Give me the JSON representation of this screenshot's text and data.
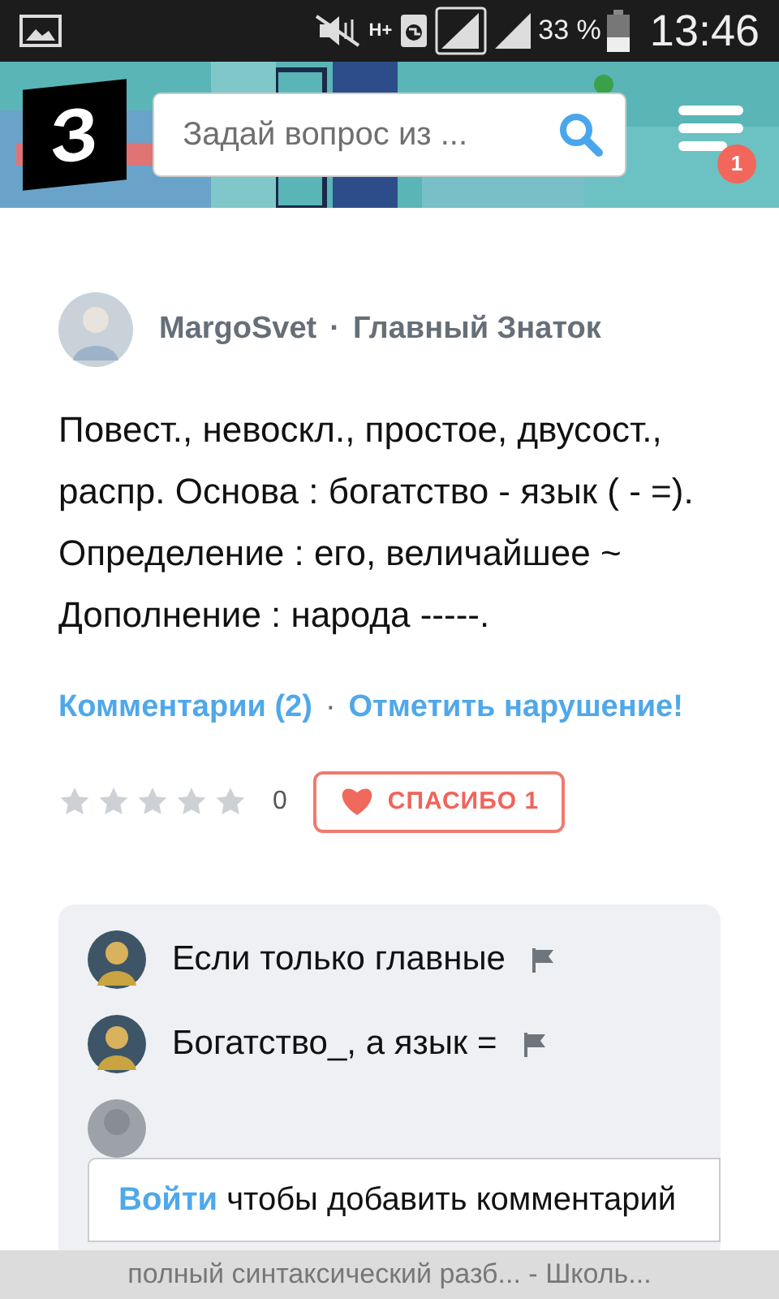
{
  "status_bar": {
    "network": "H+",
    "battery_text": "33 %",
    "time": "13:46"
  },
  "header": {
    "logo": "З",
    "search": {
      "placeholder": "Задай вопрос из ..."
    },
    "menu_badge": "1"
  },
  "answer": {
    "author": "MargoSvet",
    "separator": "·",
    "rank": "Главный Знаток",
    "text": "Повест., невоскл., простое, двусост., распр. Основа : богатство - язык ( - =). Определение : его, величайшее ~ Дополнение : народа -----.",
    "links": [
      {
        "text": "Комментарии (2)"
      },
      {
        "text": "·",
        "kind": "separator"
      },
      {
        "text": "Отметить нарушение!"
      }
    ],
    "stars": 0,
    "rating_count": "0",
    "thanks": "СПАСИБО 1"
  },
  "comments": [
    {
      "text": "Если только главные"
    },
    {
      "text": "Богатство_, а язык ="
    }
  ],
  "login_prompt": {
    "link": "Войти",
    "text": "чтобы добавить комментарий"
  },
  "page_title": "полный синтаксический разб... - Школь..."
}
